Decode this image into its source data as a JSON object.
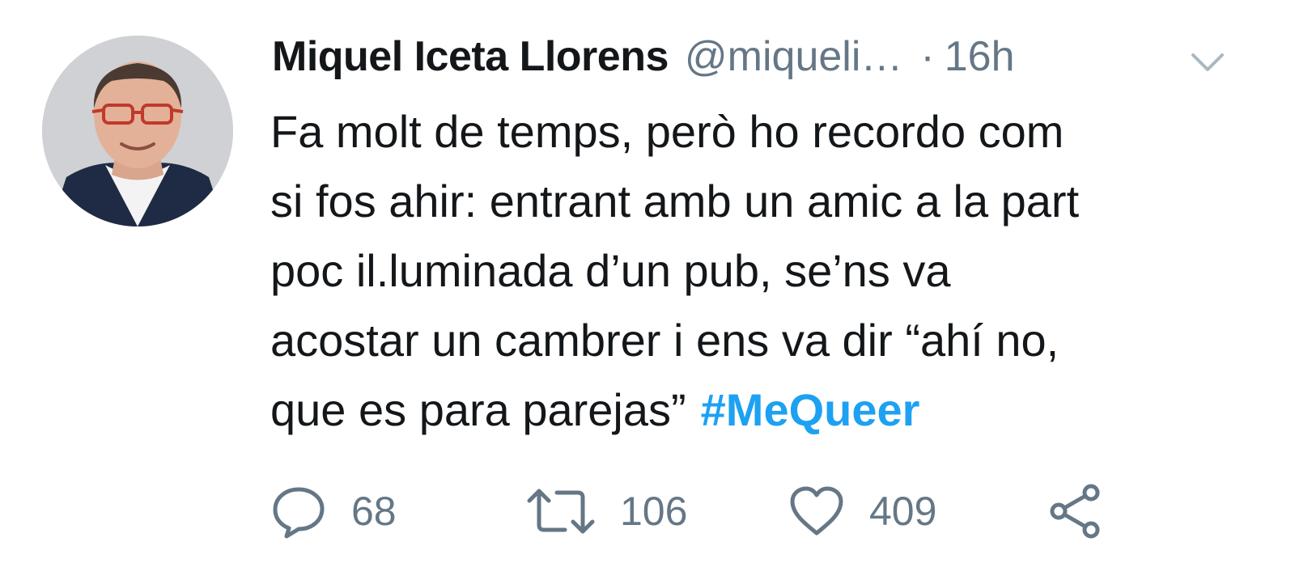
{
  "tweet": {
    "author": {
      "display_name": "Miquel Iceta Llorens",
      "handle": "@miqueli…",
      "separator": "·",
      "time": "16h"
    },
    "text_lines": [
      "Fa molt de temps, però ho recordo com",
      "si fos ahir: entrant amb un amic a la part",
      "poc il.luminada d’un pub, se’ns va",
      "acostar un cambrer i ens va dir “ahí no,",
      "que es para parejas”"
    ],
    "hashtag": "#MeQueer",
    "actions": {
      "reply_count": "68",
      "retweet_count": "106",
      "like_count": "409"
    },
    "icons": {
      "menu": "chevron-down-icon",
      "reply": "reply-icon",
      "retweet": "retweet-icon",
      "like": "heart-icon",
      "share": "share-icon"
    },
    "colors": {
      "hashtag": "#1da1f2",
      "muted": "#657786",
      "text": "#14171a"
    }
  }
}
